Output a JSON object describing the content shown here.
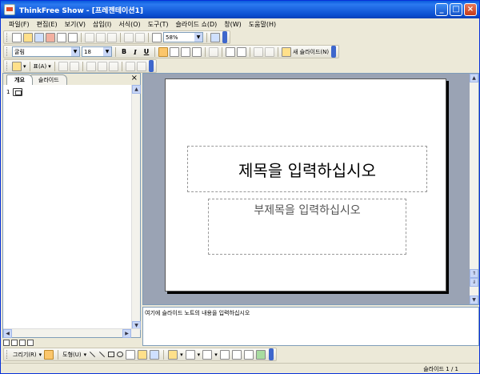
{
  "window": {
    "title": "ThinkFree Show - [프레젠테이션1]",
    "controls": {
      "minimize": "_",
      "maximize": "□",
      "close": "×"
    }
  },
  "menu": [
    "파일(F)",
    "편집(E)",
    "보기(V)",
    "삽입(I)",
    "서식(O)",
    "도구(T)",
    "슬라이드 쇼(D)",
    "창(W)",
    "도움말(H)"
  ],
  "toolbar_standard": {
    "zoom": "58%"
  },
  "toolbar_format": {
    "font_name": "굴림",
    "font_size": "18",
    "bold": "B",
    "italic": "I",
    "underline": "U",
    "new_slide": "새 슬라이드(N)"
  },
  "toolbar_table": {
    "table_label": "표(A)"
  },
  "left_pane": {
    "tabs": [
      "개요",
      "슬라이드"
    ],
    "close": "×",
    "outline_row": {
      "number": "1"
    }
  },
  "slide": {
    "title_placeholder": "제목을 입력하십시오",
    "subtitle_placeholder": "부제목을 입력하십시오"
  },
  "notes": {
    "placeholder": "여기에 슬라이드 노트의 내용을 입력하십시오"
  },
  "draw_toolbar": {
    "draw": "그리기(R)",
    "shapes": "도형(U)"
  },
  "status": {
    "slide_position": "슬라이드 1 / 1"
  },
  "colors": {
    "title_bar": "#0A5BDC",
    "chrome": "#ECE9D8",
    "work_area": "#9AA3B4",
    "slide_bg": "#FFFFFF"
  }
}
